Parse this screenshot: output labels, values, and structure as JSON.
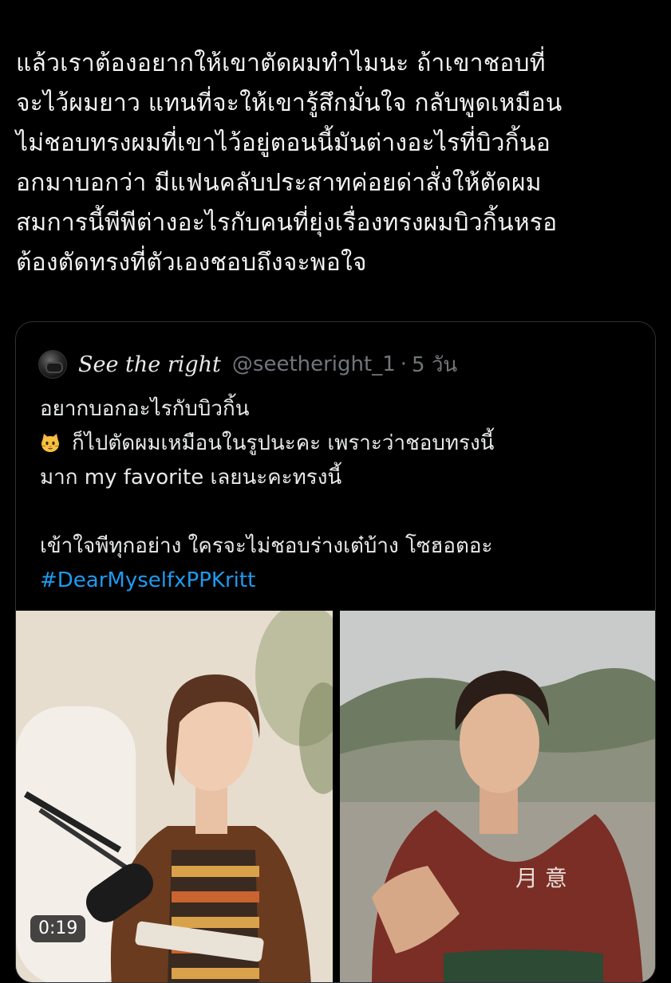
{
  "tweet": {
    "lines": [
      "แล้วเราต้องอยากให้เขาตัดผมทำไมนะ ถ้าเขาชอบที่",
      "จะไว้ผมยาว แทนที่จะให้เขารู้สึกมั่นใจ กลับพูดเหมือน",
      "ไม่ชอบทรงผมที่เขาไว้อยู่ตอนนี้มันต่างอะไรที่บิวกิ้นอ",
      "อกมาบอกว่า มีแฟนคลับประสาทค่อยด่าสั่งให้ตัดผม",
      "สมการนี้พีพีต่างอะไรกับคนที่ยุ่งเรื่องทรงผมบิวกิ้นหรอ",
      "ต้องตัดทรงที่ตัวเองชอบถึงจะพอใจ"
    ]
  },
  "quote": {
    "display_name": "See the right",
    "handle": "@seetheright_1",
    "separator": "·",
    "age": "5 วัน",
    "lines": [
      "อยากบอกอะไรกับบิวกิ้น",
      "ก็ไปตัดผมเหมือนในรูปนะคะ เพราะว่าชอบทรงนี้",
      "มาก my favorite เลยนะคะทรงนี้"
    ],
    "line_after_gap": "เข้าใจพีทุกอย่าง ใครจะไม่ชอบร่างเต๋บ้าง โซฮอตอะ",
    "hashtag": "#DearMyselfxPPKritt",
    "emoji_icon": "cat-face-emoji",
    "hashtag_color": "#1d9bf0"
  },
  "media": {
    "video_duration": "0:19",
    "shirt_text": "月 意"
  }
}
